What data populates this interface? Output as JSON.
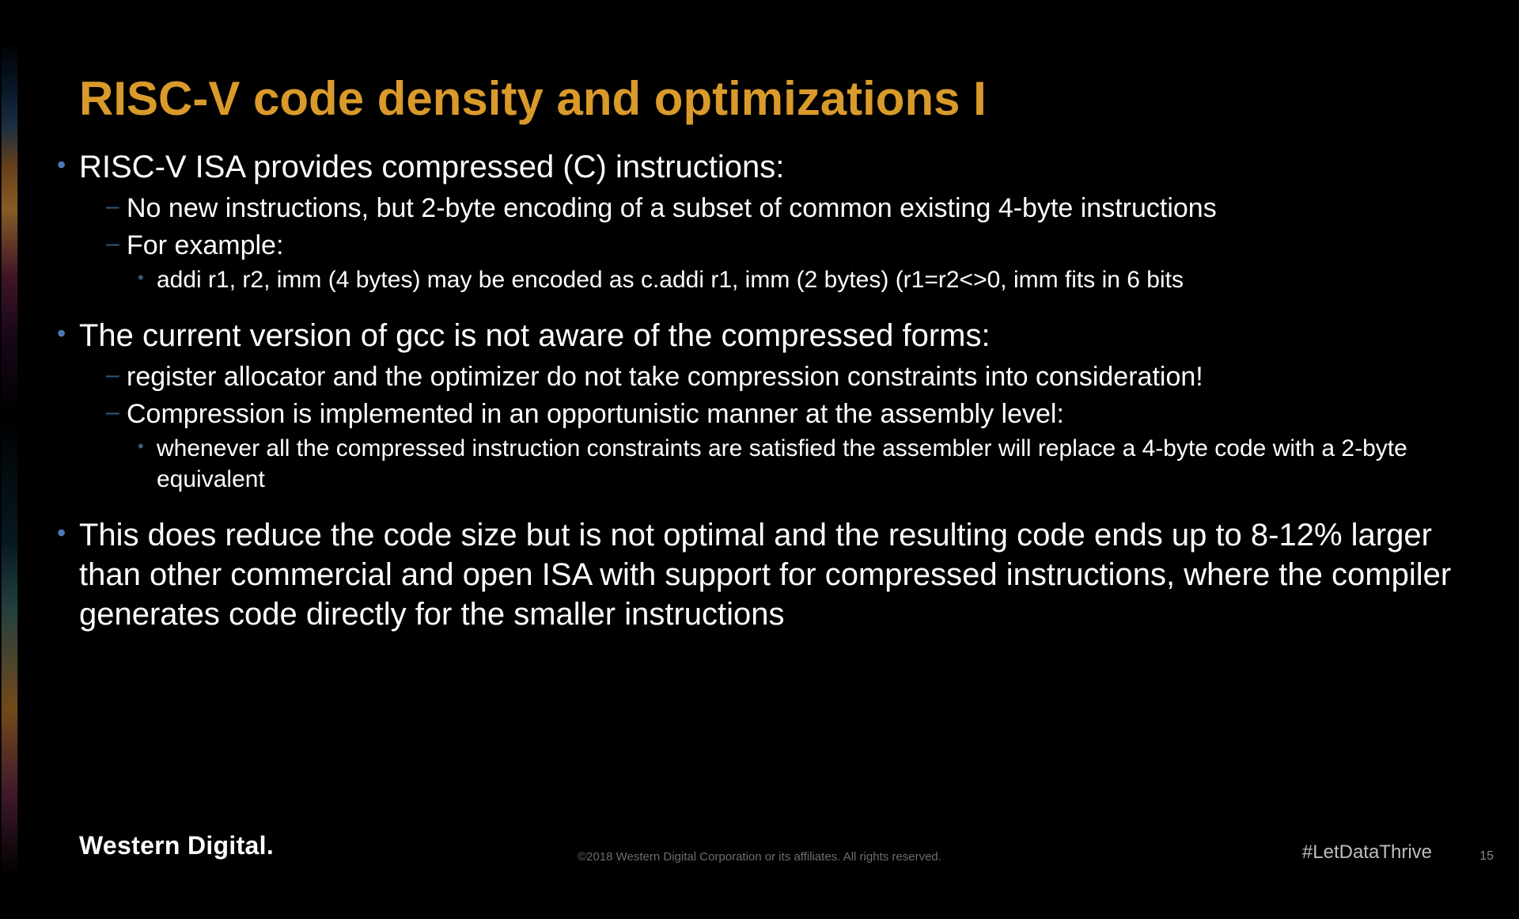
{
  "slide": {
    "title": "RISC-V code density and optimizations I",
    "bullets": [
      {
        "text": "RISC-V ISA provides compressed (C) instructions:",
        "sub": [
          {
            "text": "No new instructions, but 2-byte encoding of a subset of common existing 4-byte instructions"
          },
          {
            "text": "For example:",
            "sub": [
              {
                "text": "addi r1, r2, imm (4 bytes) may be encoded as c.addi r1, imm (2 bytes) (r1=r2<>0, imm fits in 6 bits"
              }
            ]
          }
        ]
      },
      {
        "text": "The current version of gcc is not aware of the compressed forms:",
        "sub": [
          {
            "text": "register allocator and the optimizer do not take compression constraints into consideration!"
          },
          {
            "text": "Compression is implemented in an opportunistic manner at the assembly level:",
            "sub": [
              {
                "text": "whenever all the compressed instruction constraints are satisfied the assembler will replace a 4-byte code with a 2-byte equivalent"
              }
            ]
          }
        ]
      },
      {
        "text": "This does reduce the code size but is not optimal and the resulting code ends up to 8-12% larger than other commercial and open ISA with support for compressed instructions, where the compiler generates code directly for the smaller instructions"
      }
    ]
  },
  "footer": {
    "brand": "Western Digital.",
    "copyright": "©2018 Western Digital Corporation or its affiliates. All rights reserved.",
    "hashtag": "#LetDataThrive",
    "page_number": "15"
  }
}
